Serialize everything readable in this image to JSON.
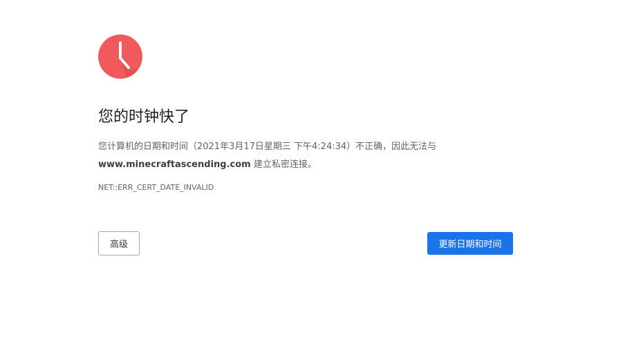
{
  "icon": {
    "name": "clock-icon",
    "color": "#f05a5a",
    "hand_color": "#ffffff"
  },
  "title": "您的时钟快了",
  "message": {
    "prefix": "您计算机的日期和时间（2021年3月17日星期三 下午4:24:34）不正确，因此无法与",
    "host": "www.minecraftascending.com",
    "suffix": " 建立私密连接。"
  },
  "error_code": "NET::ERR_CERT_DATE_INVALID",
  "buttons": {
    "advanced_label": "高级",
    "update_label": "更新日期和时间"
  },
  "colors": {
    "primary": "#1a73e8",
    "text": "#202124",
    "secondary_text": "#5f6368"
  }
}
